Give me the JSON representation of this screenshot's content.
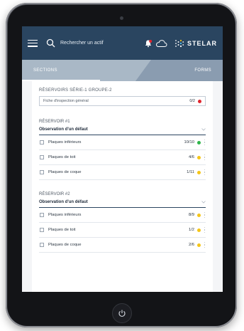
{
  "topbar": {
    "search_placeholder": "Rechercher un actif",
    "logo_text": "STELAR",
    "colors": {
      "topbar": "#2a4560",
      "tabs": "#8a9cb0",
      "tab_active": "#a9b8c6"
    }
  },
  "tabs": {
    "sections": "SECTIONS",
    "forms": "FORMS"
  },
  "group": {
    "title": "RÉSERVOIRS SÉRIE-1 GROUPE-2",
    "general": {
      "label": "Fiche d'inspection général",
      "count": "0/2",
      "status": "red"
    }
  },
  "reservoirs": [
    {
      "title": "RÉSERVOIR #1",
      "observation": "Observation d'un défaut",
      "items": [
        {
          "label": "Plaques inférieurs",
          "count": "10/10",
          "status": "green"
        },
        {
          "label": "Plaques de toit",
          "count": "4/6",
          "status": "yellow"
        },
        {
          "label": "Plaques de coque",
          "count": "1/11",
          "status": "yellow"
        }
      ]
    },
    {
      "title": "RÉSERVOIR #2",
      "observation": "Observation d'un défaut",
      "items": [
        {
          "label": "Plaques inférieurs",
          "count": "8/9",
          "status": "yellow"
        },
        {
          "label": "Plaques de toit",
          "count": "1/2",
          "status": "yellow"
        },
        {
          "label": "Plaques de coque",
          "count": "2/6",
          "status": "yellow"
        }
      ]
    }
  ],
  "status_colors": {
    "red": "#e0252e",
    "green": "#2fb54a",
    "yellow": "#f5c518"
  }
}
